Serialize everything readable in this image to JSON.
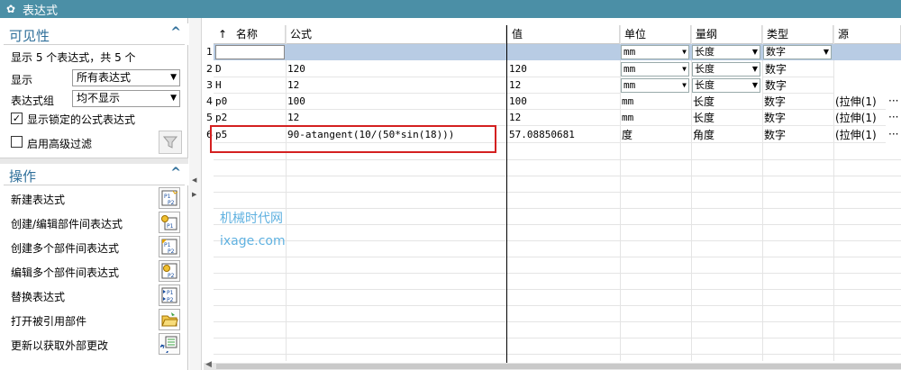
{
  "window": {
    "title": "表达式"
  },
  "visibility": {
    "title": "可见性",
    "count_text": "显示 5 个表达式，共 5 个",
    "show_label": "显示",
    "show_value": "所有表达式",
    "group_label": "表达式组",
    "group_value": "均不显示",
    "locked_label": "显示锁定的公式表达式",
    "locked_checked": true,
    "advanced_label": "启用高级过滤",
    "advanced_checked": false,
    "icons": {
      "collapse": "chevron-up-icon",
      "filter": "funnel-icon"
    }
  },
  "operations": {
    "title": "操作",
    "items": [
      {
        "label": "新建表达式",
        "icon": "new-expression-icon"
      },
      {
        "label": "创建/编辑部件间表达式",
        "icon": "interpart-edit-icon"
      },
      {
        "label": "创建多个部件间表达式",
        "icon": "multi-interpart-create-icon"
      },
      {
        "label": "编辑多个部件间表达式",
        "icon": "multi-interpart-edit-icon"
      },
      {
        "label": "替换表达式",
        "icon": "replace-expression-icon"
      },
      {
        "label": "打开被引用部件",
        "icon": "open-folder-icon"
      },
      {
        "label": "更新以获取外部更改",
        "icon": "update-external-icon"
      }
    ]
  },
  "grid": {
    "sort_indicator": "↑",
    "columns": [
      "名称",
      "公式",
      "值",
      "单位",
      "量纲",
      "类型",
      "源"
    ],
    "rows": [
      {
        "num": "1",
        "name": "",
        "formula": "",
        "value": "",
        "unit": "mm",
        "dimension": "长度",
        "type": "数字",
        "source": ""
      },
      {
        "num": "2",
        "name": "D",
        "formula": "120",
        "value": "120",
        "unit": "mm",
        "dimension": "长度",
        "type": "数字",
        "source": ""
      },
      {
        "num": "3",
        "name": "H",
        "formula": "12",
        "value": "12",
        "unit": "mm",
        "dimension": "长度",
        "type": "数字",
        "source": ""
      },
      {
        "num": "4",
        "name": "p0",
        "formula": "100",
        "value": "100",
        "unit": "mm",
        "dimension": "长度",
        "type": "数字",
        "source": "(拉伸(1)"
      },
      {
        "num": "5",
        "name": "p2",
        "formula": "12",
        "value": "12",
        "unit": "mm",
        "dimension": "长度",
        "type": "数字",
        "source": "(拉伸(1)"
      },
      {
        "num": "6",
        "name": "p5",
        "formula": "90-atangent(10/(50*sin(18)))",
        "value": "57.08850681",
        "unit": "度",
        "dimension": "角度",
        "type": "数字",
        "source": "(拉伸(1)"
      }
    ],
    "more_label": "···"
  },
  "watermark": {
    "line1": "机械时代网",
    "line2": "ixage.com"
  },
  "colors": {
    "titlebar": "#4b8fa6",
    "section_title": "#2f6f9a",
    "selected_row": "#b8cce4",
    "highlight_box": "#d42020"
  }
}
